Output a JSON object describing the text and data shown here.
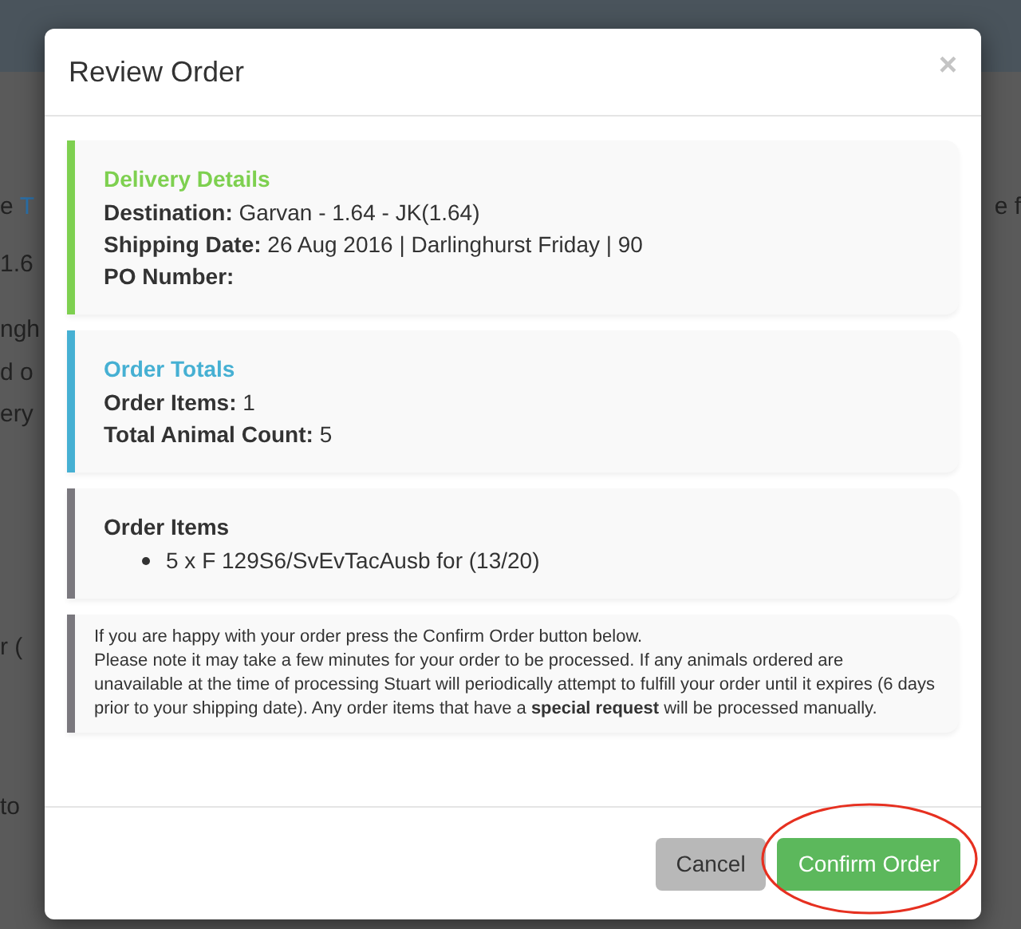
{
  "background_page": {
    "left_fragments": [
      [
        {
          "text": "e",
          "link": false
        },
        {
          "text": "T",
          "link": true
        }
      ],
      [
        {
          "text": "1.6",
          "link": false
        }
      ],
      [
        {
          "text": "ngh",
          "link": false
        }
      ],
      [
        {
          "text": "d o",
          "link": false
        }
      ],
      [
        {
          "text": "ery",
          "link": false
        }
      ],
      [
        {
          "text": "r (",
          "link": false
        }
      ],
      [
        {
          "text": "to",
          "link": false
        }
      ]
    ],
    "right_fragments": [
      "e f"
    ]
  },
  "dialog": {
    "title": "Review Order",
    "close": "×",
    "callouts": [
      {
        "kind": "details",
        "heading": "Delivery Details",
        "color": "#7ed050",
        "lines": [
          {
            "label": "Destination:",
            "value": "Garvan - 1.64 - JK(1.64)"
          },
          {
            "label": "Shipping Date:",
            "value": "26 Aug 2016 | Darlinghurst Friday | 90"
          },
          {
            "label": "PO Number:"
          }
        ]
      },
      {
        "kind": "details",
        "heading": "Order Totals",
        "color": "#46b0d3",
        "lines": [
          {
            "label": "Order Items:",
            "value": "1"
          },
          {
            "label": "Total Animal Count:",
            "value": "5"
          }
        ]
      },
      {
        "kind": "list",
        "heading": "Order Items",
        "color": "#7a787e",
        "items": [
          "5 x F 129S6/SvEvTacAusb for (13/20)"
        ]
      },
      {
        "kind": "note",
        "color": "#7a787e",
        "paragraphs": [
          "If you are happy with your order press the Confirm Order button below.",
          "Please note it may take a few minutes for your order to be processed. If any animals ordered are unavailable at the time of processing Stuart will periodically attempt to fulfill your order until it expires (6 days prior to your shipping date). Any order items that have a **special request** will be processed manually."
        ]
      }
    ],
    "buttons": [
      {
        "label": "Cancel",
        "kind": "default"
      },
      {
        "label": "Confirm Order",
        "kind": "primary"
      }
    ]
  }
}
